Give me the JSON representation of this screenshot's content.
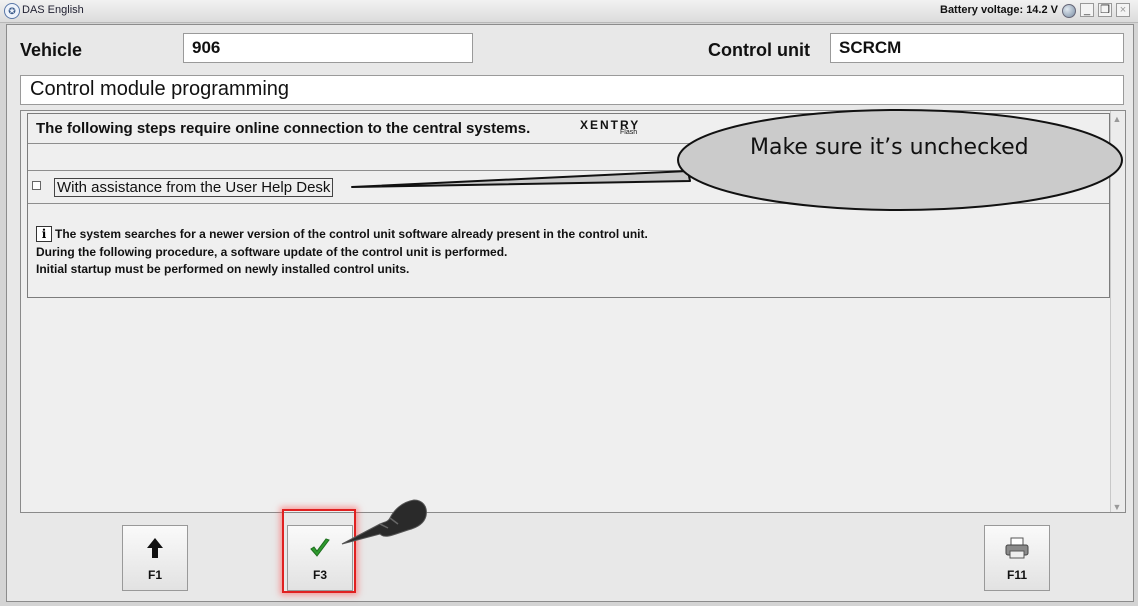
{
  "window": {
    "title": "DAS English",
    "battery": "Battery voltage: 14.2 V",
    "controls": [
      "_",
      "❒",
      "×"
    ]
  },
  "vehicle": {
    "label": "Vehicle",
    "value": "906"
  },
  "control_unit": {
    "label": "Control unit",
    "value": "SCRCM"
  },
  "page_title": "Control module programming",
  "panel": {
    "header": "The following steps require online connection to the central systems.",
    "xentry_logo": "XENTRY",
    "xentry_sub": "Flash",
    "checkbox_label": "With assistance from the User Help Desk",
    "checkbox_checked": false,
    "info_icon": "i",
    "info_lines": [
      "The system searches for a newer version of the control unit software already present in the control unit.",
      "During the following procedure, a software update of the control unit is performed.",
      "Initial startup must be performed on newly installed control units."
    ]
  },
  "annotation": {
    "callout": "Make sure it’s unchecked"
  },
  "buttons": [
    {
      "key": "F1",
      "icon": "arrow-up-icon"
    },
    {
      "key": "F3",
      "icon": "checkmark-icon",
      "highlighted": true
    },
    {
      "key": "F11",
      "icon": "printer-icon"
    }
  ],
  "colors": {
    "check": "#2e9a2e",
    "highlight": "#e02020"
  }
}
